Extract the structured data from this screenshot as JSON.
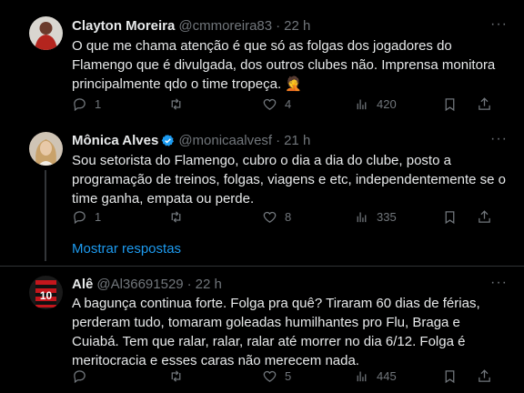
{
  "top_fragment": "∙ ✆∆∆",
  "tweets": [
    {
      "author": "Clayton Moreira",
      "handle": "@cmmoreira83",
      "separator": "·",
      "time": "22 h",
      "text": "O que me chama atenção é que só as folgas dos jogadores do Flamengo que é divulgada, dos outros clubes não. Imprensa monitora principalmente qdo o time tropeça. 🤦",
      "replies": "1",
      "retweets": "",
      "likes": "4",
      "views": "420",
      "verified": false
    },
    {
      "author": "Mônica Alves",
      "handle": "@monicaalvesf",
      "separator": "·",
      "time": "21 h",
      "text": "Sou setorista do Flamengo, cubro o dia a dia do clube, posto a programação de treinos, folgas, viagens e etc, independentemente se o time ganha, empata ou perde.",
      "replies": "1",
      "retweets": "",
      "likes": "8",
      "views": "335",
      "verified": true
    },
    {
      "author": "Alê",
      "handle": "@Al36691529",
      "separator": "·",
      "time": "22 h",
      "text": "A bagunça continua forte. Folga pra quê? Tiraram 60 dias de férias, perderam tudo, tomaram goleadas humilhantes pro Flu, Braga e Cuiabá. Tem que ralar, ralar, ralar até morrer no dia 6/12. Folga é meritocracia e esses caras não merecem nada.",
      "replies": "",
      "retweets": "",
      "likes": "5",
      "views": "445",
      "verified": false,
      "avatar_label": "10"
    }
  ],
  "show_replies_label": "Mostrar respostas",
  "more_label": "···",
  "colors": {
    "bg": "#000000",
    "text": "#e7e9ea",
    "muted": "#71767b",
    "accent": "#1d9bf0",
    "divider": "#2f3336"
  }
}
